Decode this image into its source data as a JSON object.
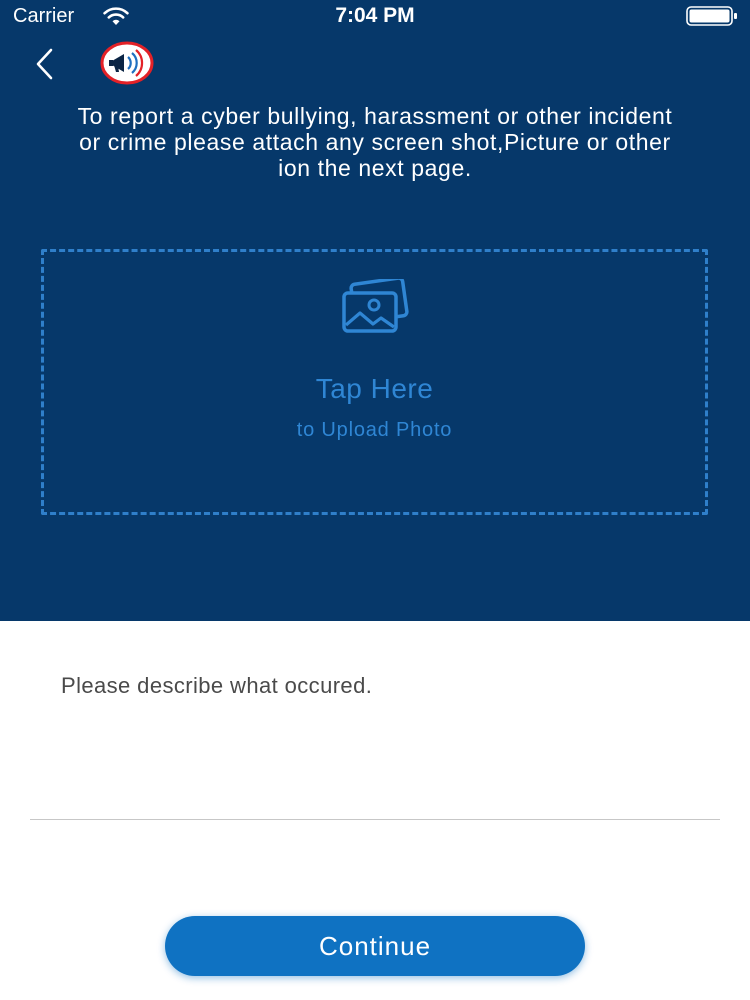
{
  "status_bar": {
    "carrier": "Carrier",
    "time": "7:04 PM"
  },
  "header": {
    "back_icon": "chevron-left-icon",
    "logo_icon": "megaphone-logo-icon"
  },
  "instructions": "To report a cyber bullying, harassment or other incident or crime please attach any screen shot,Picture or other ion the next page.",
  "upload": {
    "icon": "photos-icon",
    "title": "Tap Here",
    "subtitle": "to Upload Photo"
  },
  "describe": {
    "placeholder": "Please describe what occured."
  },
  "continue_label": "Continue",
  "colors": {
    "panel_bg": "#06386a",
    "accent": "#2f86d4",
    "button": "#0f72c2",
    "logo_ring": "#e32127"
  }
}
